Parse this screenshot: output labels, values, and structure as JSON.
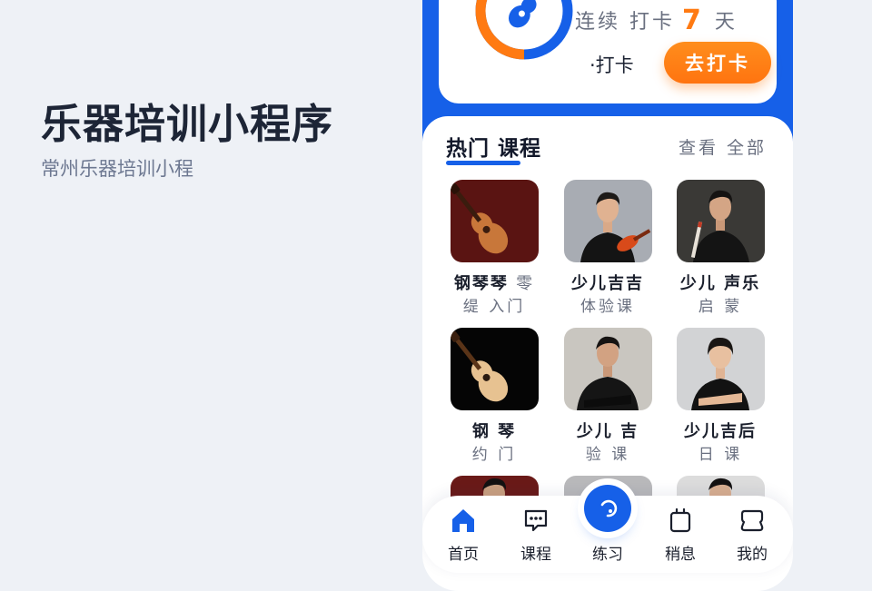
{
  "promo": {
    "title": "乐器培训小程序",
    "subtitle": "常州乐器培训小程"
  },
  "checkin": {
    "icon": "guitar-icon",
    "streak_prefix": "连续 打卡",
    "streak_days": "7",
    "streak_suffix": "天",
    "sub_label": "·打卡",
    "button_label": "去打卡",
    "progress_fraction": 0.7,
    "ring_color": "#ff7a12",
    "ring_track_color": "#1660e8"
  },
  "courses": {
    "title": "热门 课程",
    "view_all": "查看 全部",
    "items": [
      {
        "title": "钢琴琴",
        "title_extra": "零",
        "subtitle": "缇 入门",
        "image": "ukulele-on-red"
      },
      {
        "title": "少儿吉吉",
        "title_extra": "",
        "subtitle": "体验课",
        "image": "man-with-ukulele"
      },
      {
        "title": "少儿 声乐",
        "title_extra": "",
        "subtitle": "启 蒙",
        "image": "man-with-flute"
      },
      {
        "title": "钢 琴",
        "title_extra": "",
        "subtitle": "约 门",
        "image": "ukulele-on-black"
      },
      {
        "title": "少儿 吉",
        "title_extra": "",
        "subtitle": "验 课",
        "image": "man-arms-crossed"
      },
      {
        "title": "少儿吉后",
        "title_extra": "",
        "subtitle": "日 课",
        "image": "woman-arms-crossed"
      }
    ]
  },
  "tabbar": {
    "items": [
      {
        "label": "首页",
        "icon": "home-icon",
        "active": true
      },
      {
        "label": "课程",
        "icon": "course-chat-icon",
        "active": false
      },
      {
        "label": "练习",
        "icon": "practice-icon",
        "active": false
      },
      {
        "label": "稍息",
        "icon": "clipboard-icon",
        "active": false
      },
      {
        "label": "我的",
        "icon": "profile-icon",
        "active": false
      }
    ]
  },
  "colors": {
    "accent": "#1660e8",
    "orange": "#ff7a12",
    "background": "#eef1f6"
  }
}
